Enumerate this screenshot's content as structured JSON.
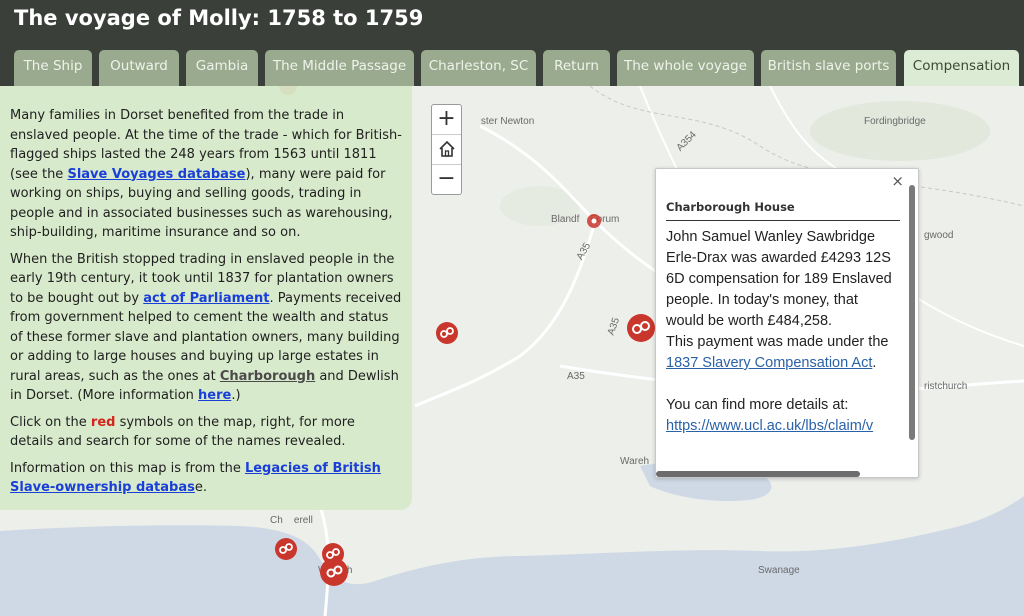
{
  "header": {
    "title": "The voyage of Molly: 1758 to 1759"
  },
  "tabs": [
    {
      "label": "The Ship",
      "active": false
    },
    {
      "label": "Outward",
      "active": false
    },
    {
      "label": "Gambia",
      "active": false
    },
    {
      "label": "The Middle Passage",
      "active": false
    },
    {
      "label": "Charleston, SC",
      "active": false
    },
    {
      "label": "Return",
      "active": false
    },
    {
      "label": "The whole voyage",
      "active": false
    },
    {
      "label": "British slave ports",
      "active": false
    },
    {
      "label": "Compensation",
      "active": true
    }
  ],
  "panel": {
    "p1_a": "Many families in Dorset benefited from the trade in enslaved people. At the time of the trade - which for British-flagged ships lasted the 248 years from 1563 until 1811 (see the ",
    "p1_link": "Slave Voyages database",
    "p1_b": "), many were paid for working on ships, buying and selling goods, trading in people and in associated businesses such as warehousing, ship-building, maritime insurance and so on.",
    "p2_a": "When the British stopped trading in enslaved people in the early 19th century, it took until 1837 for plantation owners to be bought out by ",
    "p2_link": "act of Parliament",
    "p2_b": ". Payments received from government helped to cement the wealth and status of these former slave and plantation owners, many building or adding to large houses and buying up large estates in rural areas, such as the ones at ",
    "p2_link2": "Charborough",
    "p2_c": " and Dewlish in Dorset. (More information ",
    "p2_link3": "here",
    "p2_d": ".)",
    "p3_a": "Click on the ",
    "p3_red": "red",
    "p3_b": " symbols on the map, right, for more details and search for some of the names revealed.",
    "p4_a": "Information on this map is from the ",
    "p4_link": "Legacies of British Slave-ownership databas",
    "p4_b": "e."
  },
  "zoom": {
    "in": "+",
    "home_icon": "home-icon",
    "out": "−"
  },
  "popup": {
    "close": "×",
    "title": "Charborough House",
    "body_a": "John Samuel Wanley Sawbridge Erle-Drax was awarded £4293 12S 6D compensation for 189 Enslaved people. In today's money, that would be worth £484,258.",
    "body_b": "This payment was made under the ",
    "body_link": "1837 Slavery Compensation Act",
    "body_c": ".",
    "body_d": "You can find more details at: ",
    "body_url": "https://www.ucl.ac.uk/lbs/claim/v"
  },
  "map_labels": {
    "sturminster": "St       ster Newton",
    "blandford": "Blandf    Forum",
    "fordingbridge": "Fordingbridge",
    "ringwood": "gwood",
    "christchurch": "ristchurch",
    "swanage": "Swanage",
    "wareham": "Wareh",
    "chaldon": "Ch    erell",
    "weymouth": "W      th",
    "a354": "A354",
    "a35a": "A35",
    "a35b": "A35",
    "a350": "A35"
  },
  "colors": {
    "header": "#3a3f3a",
    "tab": "#9aaa8e",
    "tab_active": "#dcebd3",
    "panel": "#d6eac9",
    "marker": "#c9362b",
    "link": "#1a3fd8"
  }
}
